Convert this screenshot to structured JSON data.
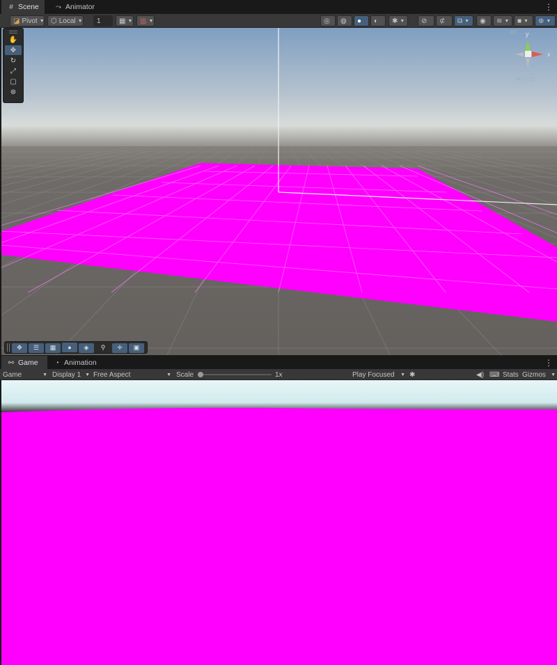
{
  "scene_tabs": [
    {
      "label": "Scene",
      "icon": "grid-icon",
      "active": true
    },
    {
      "label": "Animator",
      "icon": "animator-icon",
      "active": false
    }
  ],
  "scene_toolbar": {
    "pivot_label": "Pivot",
    "local_label": "Local",
    "snap_value": "1"
  },
  "orientation_gizmo": {
    "y_label": "y",
    "x_label": "x",
    "mode_label": "Persp"
  },
  "game_tabs": [
    {
      "label": "Game",
      "icon": "gamepad-icon",
      "active": true
    },
    {
      "label": "Animation",
      "icon": "clock-icon",
      "active": false
    }
  ],
  "game_toolbar": {
    "view_select": "Game",
    "display_select": "Display 1",
    "aspect_select": "Free Aspect",
    "scale_label": "Scale",
    "scale_value": "1x",
    "scale_fraction": 0.0,
    "play_mode_select": "Play Focused",
    "stats_label": "Stats",
    "gizmos_label": "Gizmos"
  },
  "colors": {
    "plane": "#ff00ff",
    "sky_top": "#7f9ec2",
    "ground": "#6e6b68",
    "accent": "#46607c"
  }
}
